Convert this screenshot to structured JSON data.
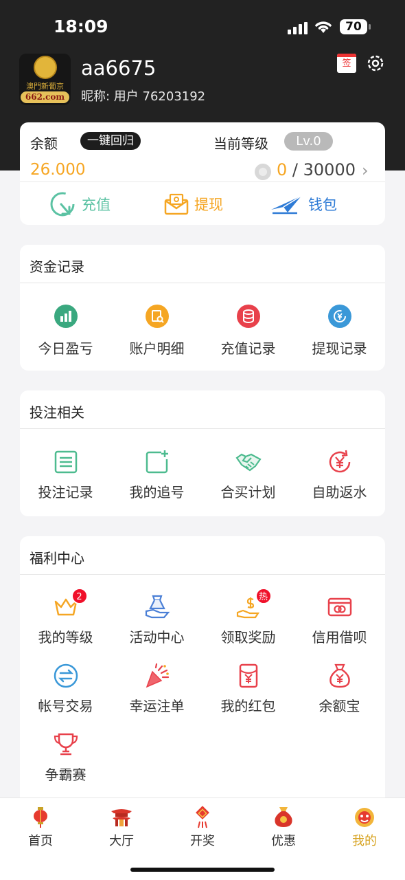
{
  "status_bar": {
    "time": "18:09",
    "battery": "70"
  },
  "profile": {
    "logo_text": "澳門新葡京",
    "logo_domain": "662.com",
    "username": "aa6675",
    "nickname": "昵称: 用户 76203192",
    "signin_label": "签"
  },
  "balance_card": {
    "balance_label": "余额",
    "recall_button": "一键回归",
    "level_label": "当前等级",
    "level_badge": "Lv.0",
    "balance": "26.000",
    "progress_current": "0",
    "progress_total": "/ 30000",
    "chevron": "›",
    "actions": [
      {
        "label": "充值",
        "icon": "recharge-icon",
        "color": "#5bc2a3"
      },
      {
        "label": "提现",
        "icon": "withdraw-icon",
        "color": "#f5a623"
      },
      {
        "label": "钱包",
        "icon": "wallet-plane-icon",
        "color": "#2e7bd6"
      }
    ]
  },
  "funds_section": {
    "title": "资金记录",
    "items": [
      {
        "label": "今日盈亏",
        "icon": "chart-bars-icon",
        "color": "#3aa87f"
      },
      {
        "label": "账户明细",
        "icon": "receipt-search-icon",
        "color": "#f5a623"
      },
      {
        "label": "充值记录",
        "icon": "coins-stack-icon",
        "color": "#e8414b"
      },
      {
        "label": "提现记录",
        "icon": "yen-exchange-icon",
        "color": "#3a98d8"
      }
    ]
  },
  "bet_section": {
    "title": "投注相关",
    "items": [
      {
        "label": "投注记录",
        "icon": "list-icon",
        "color": "#4dbb8f"
      },
      {
        "label": "我的追号",
        "icon": "add-square-icon",
        "color": "#4dbb8f"
      },
      {
        "label": "合买计划",
        "icon": "handshake-icon",
        "color": "#4dbb8f"
      },
      {
        "label": "自助返水",
        "icon": "yen-refresh-icon",
        "color": "#e8414b"
      }
    ]
  },
  "welfare_section": {
    "title": "福利中心",
    "items": [
      {
        "label": "我的等级",
        "icon": "crown-icon",
        "color": "#f5a623",
        "badge": "2"
      },
      {
        "label": "活动中心",
        "icon": "gift-hand-icon",
        "color": "#4a7fd6"
      },
      {
        "label": "领取奖励",
        "icon": "dollar-hand-icon",
        "color": "#f5a623",
        "badge": "热"
      },
      {
        "label": "信用借呗",
        "icon": "card-icon",
        "color": "#e8414b"
      },
      {
        "label": "帐号交易",
        "icon": "swap-icon",
        "color": "#3a98d8"
      },
      {
        "label": "幸运注单",
        "icon": "party-popper-icon",
        "color": "#e8414b"
      },
      {
        "label": "我的红包",
        "icon": "red-envelope-icon",
        "color": "#e8414b"
      },
      {
        "label": "余额宝",
        "icon": "money-bag-icon",
        "color": "#e8414b"
      },
      {
        "label": "争霸赛",
        "icon": "trophy-icon",
        "color": "#e8414b"
      }
    ]
  },
  "tab_bar": {
    "items": [
      {
        "label": "首页",
        "icon": "lantern-icon"
      },
      {
        "label": "大厅",
        "icon": "temple-icon"
      },
      {
        "label": "开奖",
        "icon": "knot-icon"
      },
      {
        "label": "优惠",
        "icon": "fortune-bag-icon"
      },
      {
        "label": "我的",
        "icon": "lion-icon",
        "active": true
      }
    ]
  },
  "colors": {
    "header_bg": "#222222",
    "accent_gold": "#d7a321",
    "balance_orange": "#f6a623"
  }
}
